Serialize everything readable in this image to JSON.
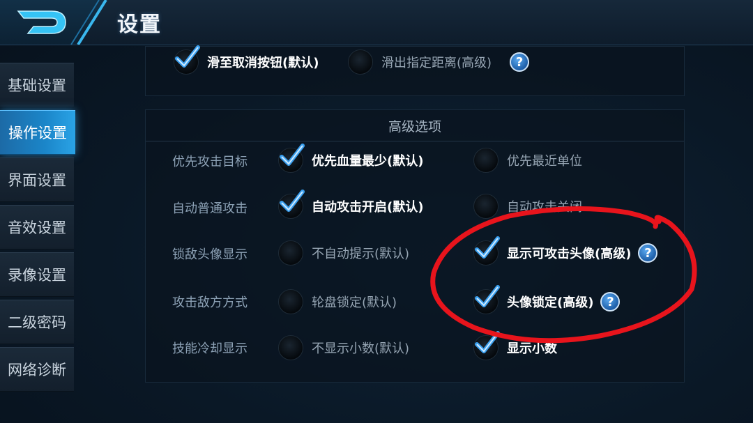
{
  "header": {
    "title": "设置"
  },
  "sidebar": {
    "items": [
      {
        "label": "基础设置",
        "active": false
      },
      {
        "label": "操作设置",
        "active": true
      },
      {
        "label": "界面设置",
        "active": false
      },
      {
        "label": "音效设置",
        "active": false
      },
      {
        "label": "录像设置",
        "active": false
      },
      {
        "label": "二级密码",
        "active": false
      },
      {
        "label": "网络诊断",
        "active": false
      }
    ]
  },
  "top_row": {
    "option_a": "滑至取消按钮(默认)",
    "option_b": "滑出指定距离(高级)",
    "help": "?"
  },
  "advanced": {
    "title": "高级选项",
    "rows": [
      {
        "label": "优先攻击目标",
        "a": "优先血量最少(默认)",
        "b": "优先最近单位"
      },
      {
        "label": "自动普通攻击",
        "a": "自动攻击开启(默认)",
        "b": "自动攻击关闭"
      },
      {
        "label": "锁敌头像显示",
        "a": "不自动提示(默认)",
        "b": "显示可攻击头像(高级)"
      },
      {
        "label": "攻击敌方方式",
        "a": "轮盘锁定(默认)",
        "b": "头像锁定(高级)"
      },
      {
        "label": "技能冷却显示",
        "a": "不显示小数(默认)",
        "b": "显示小数"
      }
    ],
    "help": "?"
  },
  "colors": {
    "accent": "#1b86c9",
    "check": "#3aa0f0",
    "annotation": "#e8141c"
  }
}
